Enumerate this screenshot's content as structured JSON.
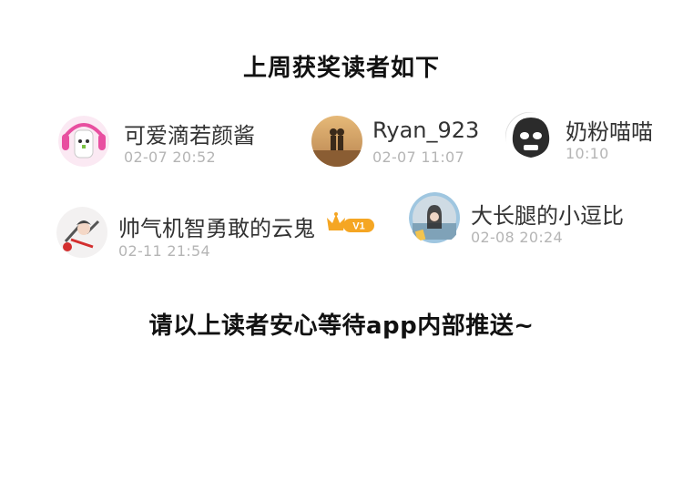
{
  "title": "上周获奖读者如下",
  "footer": "请以上读者安心等待app内部推送~",
  "winners": [
    {
      "name": "可爱滴若颜酱",
      "time": "02-07 20:52",
      "avatar": "bunny-headphones-avatar"
    },
    {
      "name": "Ryan_923",
      "time": "02-07 11:07",
      "avatar": "couple-sunset-avatar"
    },
    {
      "name": "奶粉喵喵",
      "time": "10:10",
      "avatar": "meme-face-avatar"
    },
    {
      "name": "帅气机智勇敢的云鬼",
      "time": "02-11 21:54",
      "avatar": "anime-character-avatar",
      "badge": "V1"
    },
    {
      "name": "大长腿的小逗比",
      "time": "02-08 20:24",
      "avatar": "girl-photo-avatar"
    }
  ],
  "colors": {
    "time_text": "#b5b5b5",
    "name_text": "#333333",
    "badge_orange": "#f5a623"
  }
}
